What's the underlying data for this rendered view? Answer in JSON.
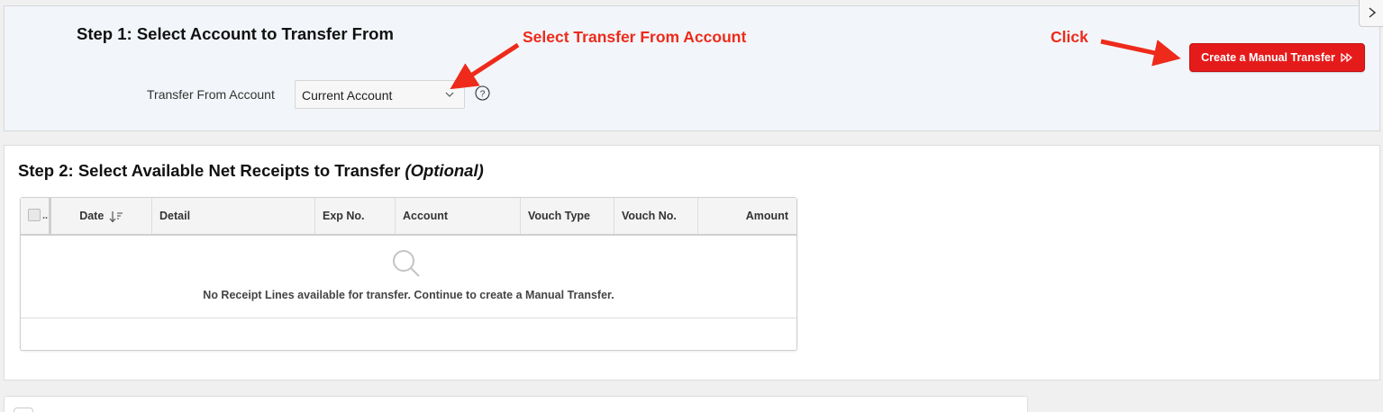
{
  "step1": {
    "title": "Step 1: Select Account to Transfer From",
    "transfer_from_label": "Transfer From Account",
    "transfer_from_value": "Current Account",
    "create_button_label": "Create a Manual Transfer"
  },
  "annotations": {
    "select_from": "Select Transfer From Account",
    "click": "Click",
    "color": "#ee2a1b"
  },
  "step2": {
    "title": "Step 2: Select Available Net Receipts to Transfer",
    "title_optional": "(Optional)",
    "columns": {
      "select": "..",
      "date": "Date",
      "detail": "Detail",
      "exp_no": "Exp No.",
      "account": "Account",
      "vouch_type": "Vouch Type",
      "vouch_no": "Vouch No.",
      "amount": "Amount"
    },
    "empty_message": "No Receipt Lines available for transfer. Continue to create a Manual Transfer."
  },
  "icons": {
    "chevron": "chevron-down-icon",
    "help": "help-icon",
    "fast_forward": "fast-forward-icon",
    "sort": "sort-descending-icon",
    "search": "search-icon",
    "collapse": "chevron-right-icon"
  },
  "colors": {
    "primary_button": "#e51b1b",
    "region_background": "#f2f6fa"
  }
}
